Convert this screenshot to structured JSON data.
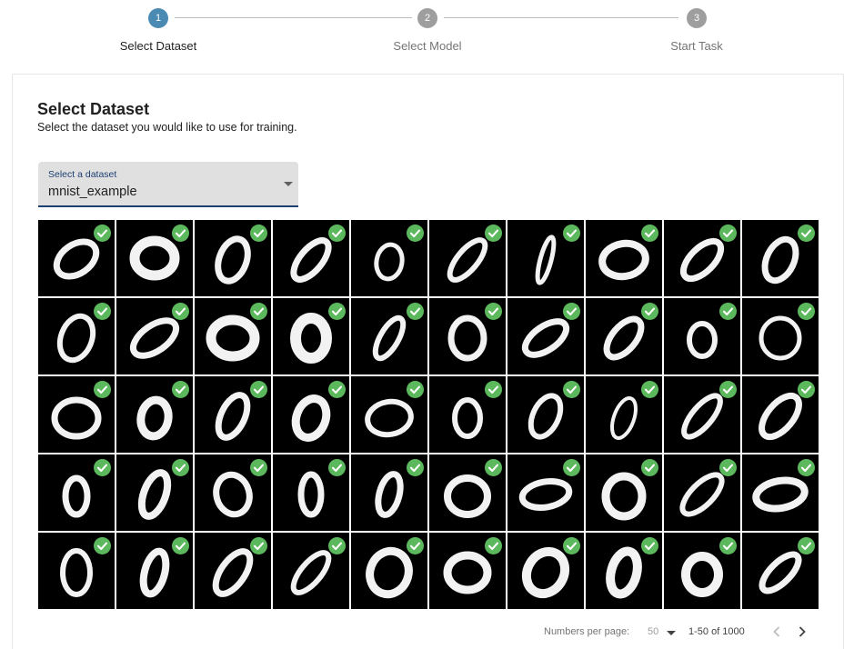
{
  "stepper": {
    "steps": [
      {
        "number": "1",
        "label": "Select Dataset",
        "state": "active"
      },
      {
        "number": "2",
        "label": "Select Model",
        "state": "inactive"
      },
      {
        "number": "3",
        "label": "Start Task",
        "state": "inactive"
      }
    ]
  },
  "main": {
    "title": "Select Dataset",
    "subtitle": "Select the dataset you would like to use for training."
  },
  "dataset_select": {
    "label": "Select a dataset",
    "value": "mnist_example"
  },
  "image_grid": {
    "items": [
      {
        "digit": "0",
        "selected": true
      },
      {
        "digit": "0",
        "selected": true
      },
      {
        "digit": "0",
        "selected": true
      },
      {
        "digit": "0",
        "selected": true
      },
      {
        "digit": "0",
        "selected": true
      },
      {
        "digit": "0",
        "selected": true
      },
      {
        "digit": "0",
        "selected": true
      },
      {
        "digit": "0",
        "selected": true
      },
      {
        "digit": "0",
        "selected": true
      },
      {
        "digit": "0",
        "selected": true
      },
      {
        "digit": "0",
        "selected": true
      },
      {
        "digit": "0",
        "selected": true
      },
      {
        "digit": "0",
        "selected": true
      },
      {
        "digit": "0",
        "selected": true
      },
      {
        "digit": "0",
        "selected": true
      },
      {
        "digit": "0",
        "selected": true
      },
      {
        "digit": "0",
        "selected": true
      },
      {
        "digit": "0",
        "selected": true
      },
      {
        "digit": "0",
        "selected": true
      },
      {
        "digit": "0",
        "selected": true
      },
      {
        "digit": "0",
        "selected": true
      },
      {
        "digit": "0",
        "selected": true
      },
      {
        "digit": "0",
        "selected": true
      },
      {
        "digit": "0",
        "selected": true
      },
      {
        "digit": "0",
        "selected": true
      },
      {
        "digit": "0",
        "selected": true
      },
      {
        "digit": "0",
        "selected": true
      },
      {
        "digit": "0",
        "selected": true
      },
      {
        "digit": "0",
        "selected": true
      },
      {
        "digit": "0",
        "selected": true
      },
      {
        "digit": "0",
        "selected": true
      },
      {
        "digit": "0",
        "selected": true
      },
      {
        "digit": "0",
        "selected": true
      },
      {
        "digit": "0",
        "selected": true
      },
      {
        "digit": "0",
        "selected": true
      },
      {
        "digit": "0",
        "selected": true
      },
      {
        "digit": "0",
        "selected": true
      },
      {
        "digit": "0",
        "selected": true
      },
      {
        "digit": "0",
        "selected": true
      },
      {
        "digit": "0",
        "selected": true
      },
      {
        "digit": "0",
        "selected": true
      },
      {
        "digit": "0",
        "selected": true
      },
      {
        "digit": "0",
        "selected": true
      },
      {
        "digit": "0",
        "selected": true
      },
      {
        "digit": "0",
        "selected": true
      },
      {
        "digit": "0",
        "selected": true
      },
      {
        "digit": "0",
        "selected": true
      },
      {
        "digit": "0",
        "selected": true
      },
      {
        "digit": "0",
        "selected": true
      },
      {
        "digit": "0",
        "selected": true
      }
    ]
  },
  "pagination": {
    "per_page_label": "Numbers per page:",
    "per_page_value": "50",
    "range_text": "1-50 of 1000",
    "prev_icon": "chevron-left-icon",
    "next_icon": "chevron-right-icon"
  },
  "colors": {
    "active_step": "#4a8ab3",
    "inactive_step": "#9e9e9e",
    "check_badge": "#5cb85c",
    "select_underline": "#1e3f73"
  }
}
